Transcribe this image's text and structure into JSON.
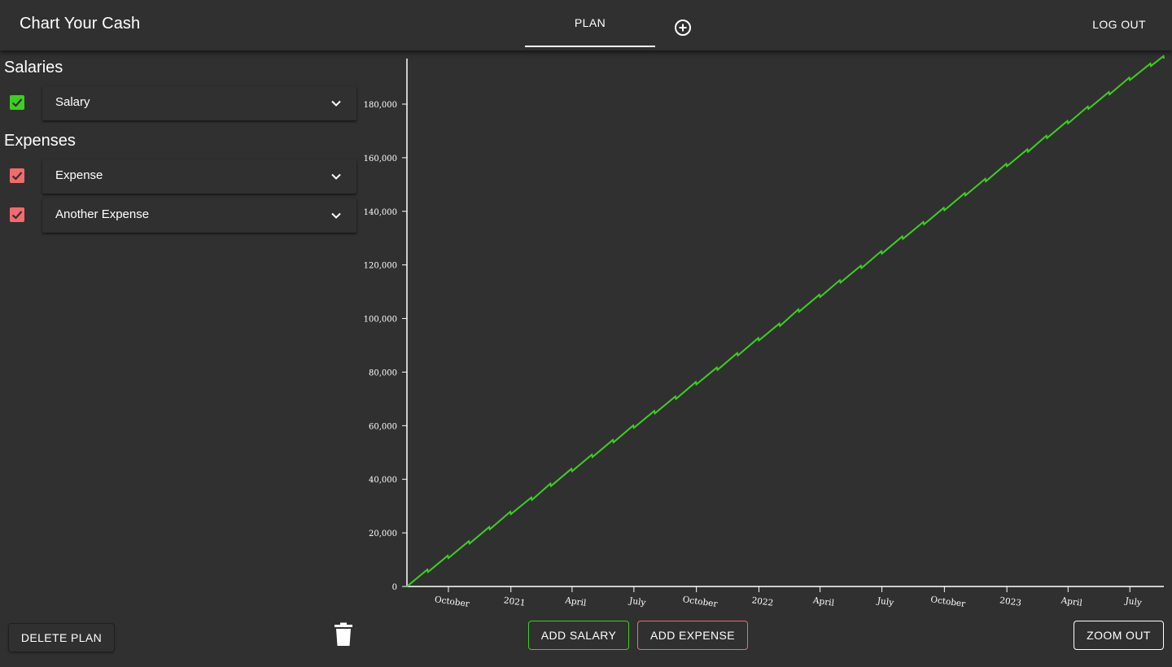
{
  "app": {
    "title": "Chart Your Cash"
  },
  "nav": {
    "plan_tab": "PLAN",
    "add_plan_icon": "add-circle-icon",
    "logout": "LOG OUT"
  },
  "sidebar": {
    "salaries_title": "Salaries",
    "salaries": [
      {
        "label": "Salary",
        "checked": true,
        "color": "#3cd01f"
      }
    ],
    "expenses_title": "Expenses",
    "expenses": [
      {
        "label": "Expense",
        "checked": true,
        "color": "#f26b6b"
      },
      {
        "label": "Another Expense",
        "checked": true,
        "color": "#f26b6b"
      }
    ],
    "delete_plan": "DELETE PLAN",
    "trash_icon": "trash-icon"
  },
  "actions": {
    "add_salary": "ADD SALARY",
    "add_expense": "ADD EXPENSE",
    "zoom_out": "ZOOM OUT"
  },
  "colors": {
    "background": "#303030",
    "salary": "#3cd01f",
    "expense": "#f26b6b",
    "line": "#3cd01f"
  },
  "chart_data": {
    "type": "line",
    "title": "",
    "xlabel": "",
    "ylabel": "",
    "x_start": "2020-08-01",
    "x_end": "2023-08-20",
    "ylim": [
      0,
      197000
    ],
    "y_ticks": [
      0,
      20000,
      40000,
      60000,
      80000,
      100000,
      120000,
      140000,
      160000,
      180000
    ],
    "y_tick_labels": [
      "0",
      "20,000",
      "40,000",
      "60,000",
      "80,000",
      "100,000",
      "120,000",
      "140,000",
      "160,000",
      "180,000"
    ],
    "x_ticks": [
      "2020-10-01",
      "2021-01-01",
      "2021-04-01",
      "2021-07-01",
      "2021-10-01",
      "2022-01-01",
      "2022-04-01",
      "2022-07-01",
      "2022-10-01",
      "2023-01-01",
      "2023-04-01",
      "2023-07-01"
    ],
    "x_tick_labels": [
      "October",
      "2021",
      "April",
      "July",
      "October",
      "2022",
      "April",
      "July",
      "October",
      "2023",
      "April",
      "July"
    ],
    "series": [
      {
        "color": "#3cd01f",
        "points": [
          [
            "2020-08-01",
            0
          ],
          [
            "2020-09-01",
            5400
          ],
          [
            "2020-10-01",
            10600
          ],
          [
            "2020-11-01",
            16000
          ],
          [
            "2020-12-01",
            21300
          ],
          [
            "2021-01-01",
            27000
          ],
          [
            "2021-02-01",
            32300
          ],
          [
            "2021-03-01",
            37500
          ],
          [
            "2021-04-01",
            43000
          ],
          [
            "2021-05-01",
            48300
          ],
          [
            "2021-06-01",
            53800
          ],
          [
            "2021-07-01",
            59200
          ],
          [
            "2021-08-01",
            64600
          ],
          [
            "2021-09-01",
            70000
          ],
          [
            "2021-10-01",
            75400
          ],
          [
            "2021-11-01",
            80800
          ],
          [
            "2021-12-01",
            86200
          ],
          [
            "2022-01-01",
            91800
          ],
          [
            "2022-02-01",
            97200
          ],
          [
            "2022-03-01",
            102500
          ],
          [
            "2022-04-01",
            108000
          ],
          [
            "2022-05-01",
            113400
          ],
          [
            "2022-06-01",
            118800
          ],
          [
            "2022-07-01",
            124200
          ],
          [
            "2022-08-01",
            129700
          ],
          [
            "2022-09-01",
            135100
          ],
          [
            "2022-10-01",
            140400
          ],
          [
            "2022-11-01",
            145900
          ],
          [
            "2022-12-01",
            151200
          ],
          [
            "2023-01-01",
            156800
          ],
          [
            "2023-02-01",
            162200
          ],
          [
            "2023-03-01",
            167300
          ],
          [
            "2023-04-01",
            172800
          ],
          [
            "2023-05-01",
            178200
          ],
          [
            "2023-06-01",
            183600
          ],
          [
            "2023-07-01",
            189000
          ],
          [
            "2023-08-01",
            194200
          ],
          [
            "2023-08-20",
            197000
          ]
        ]
      }
    ]
  }
}
